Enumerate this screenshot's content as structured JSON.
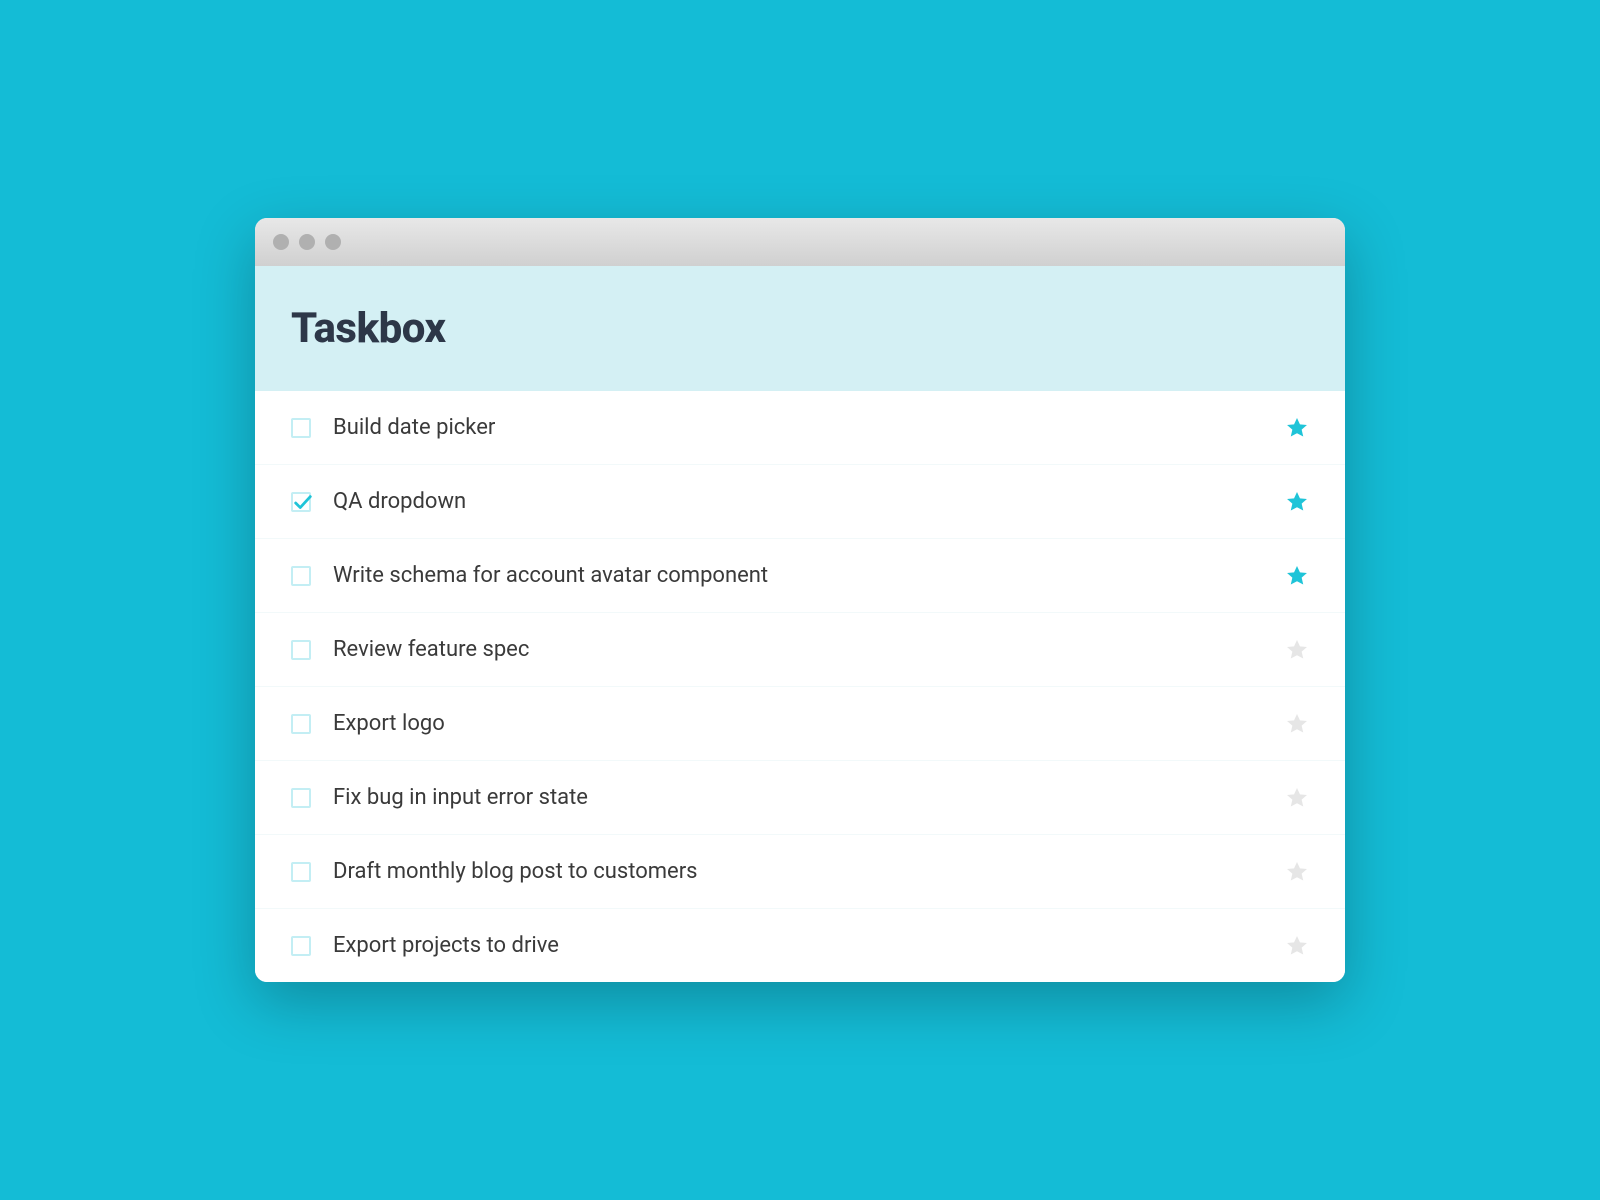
{
  "header": {
    "title": "Taskbox"
  },
  "tasks": [
    {
      "title": "Build date picker",
      "checked": false,
      "starred": true
    },
    {
      "title": "QA dropdown",
      "checked": true,
      "starred": true
    },
    {
      "title": "Write schema for account avatar component",
      "checked": false,
      "starred": true
    },
    {
      "title": "Review feature spec",
      "checked": false,
      "starred": false
    },
    {
      "title": "Export logo",
      "checked": false,
      "starred": false
    },
    {
      "title": "Fix bug in input error state",
      "checked": false,
      "starred": false
    },
    {
      "title": "Draft monthly blog post to customers",
      "checked": false,
      "starred": false
    },
    {
      "title": "Export projects to drive",
      "checked": false,
      "starred": false
    }
  ],
  "colors": {
    "background": "#14bcd6",
    "header_bg": "#d4f0f4",
    "star_active": "#1fc4d8",
    "star_inactive": "#e6e6e6",
    "checkbox_border": "#c3eef4",
    "text_dark": "#2d3748"
  }
}
